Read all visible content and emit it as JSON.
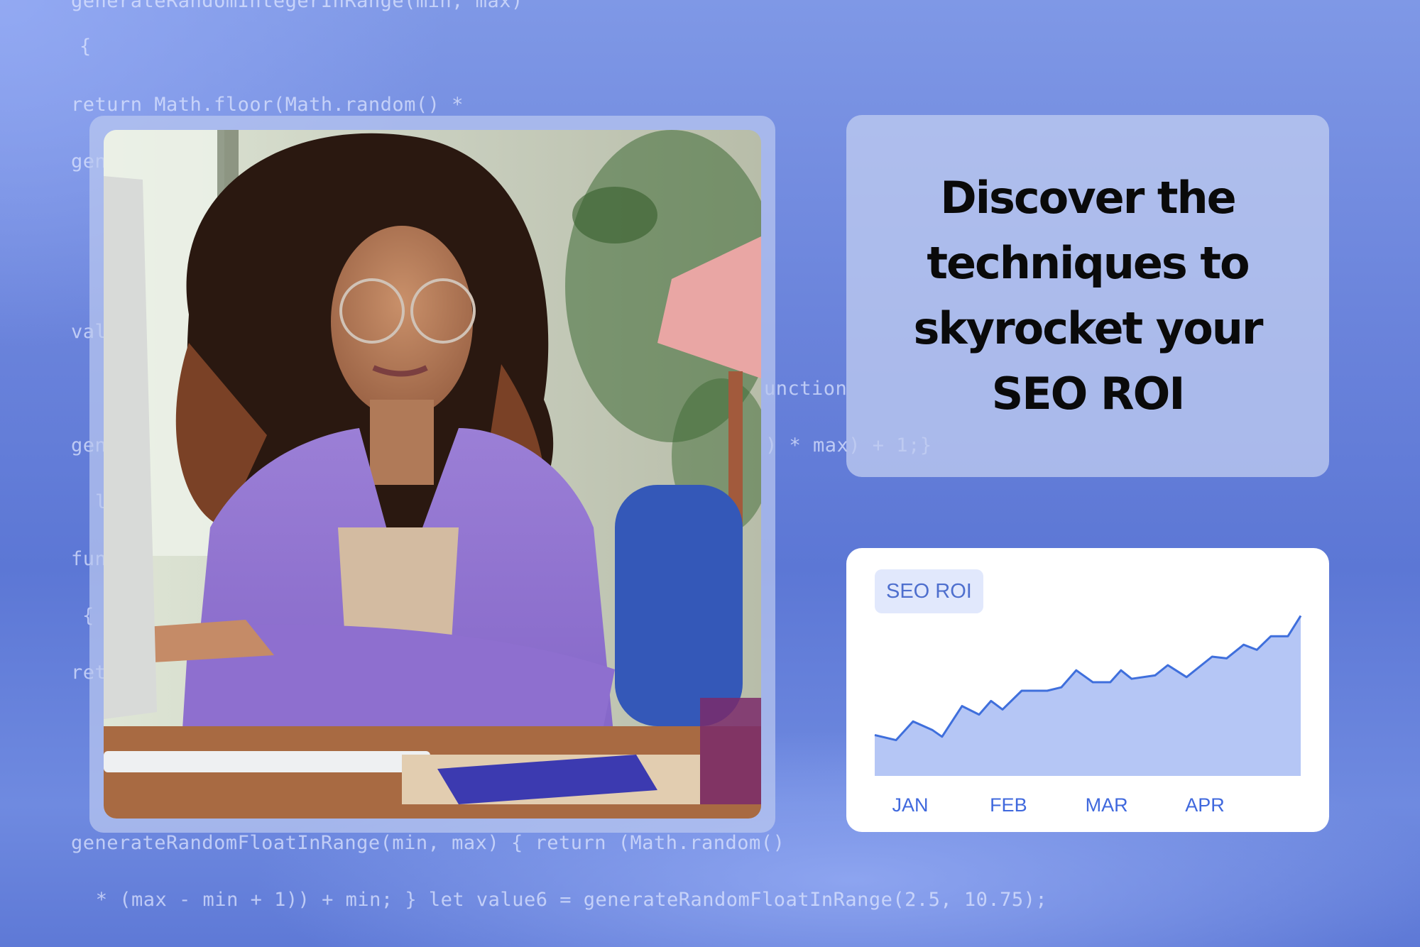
{
  "background_code": {
    "lines": [
      "return Math.floor(Math.random() *",
      "{",
      "gen",
      "val",
      "unction",
      "gen",
      ") * max) + 1;}",
      "l",
      "fun",
      "{",
      "ret",
      "generateRandomFloatInRange(min, max) { return (Math.random()",
      " * (max - min + 1)) + min; } let value6 = generateRandomFloatInRange(2.5, 10.75);"
    ]
  },
  "photo": {
    "description": "Smiling woman with curly hair and round glasses in a purple blazer at a desk with a computer, keyboard, notebook and pen cup"
  },
  "headline": {
    "text": "Discover the techniques to skyrocket your SEO ROI"
  },
  "chart": {
    "badge_label": "SEO ROI"
  },
  "colors": {
    "accent_line": "#3f6fdc",
    "area_fill": "#b5c6f5",
    "badge_bg": "#e1e8fc",
    "badge_text": "#4e6fce"
  },
  "chart_data": {
    "type": "area",
    "title": "SEO ROI",
    "xlabel": "",
    "ylabel": "",
    "x_tick_labels": [
      "JAN",
      "FEB",
      "MAR",
      "APR"
    ],
    "grid": false,
    "legend": "none",
    "ylim": [
      0,
      100
    ],
    "x": [
      0,
      0.05,
      0.09,
      0.135,
      0.158,
      0.205,
      0.245,
      0.273,
      0.3,
      0.345,
      0.405,
      0.438,
      0.473,
      0.512,
      0.553,
      0.578,
      0.603,
      0.658,
      0.688,
      0.732,
      0.792,
      0.826,
      0.866,
      0.897,
      0.93,
      0.97,
      1.0
    ],
    "values": [
      24,
      21,
      32,
      27,
      23,
      41,
      36,
      44,
      39,
      50,
      50,
      52,
      62,
      55,
      55,
      62,
      57,
      59,
      65,
      58,
      70,
      69,
      77,
      74,
      82,
      82,
      94
    ]
  }
}
